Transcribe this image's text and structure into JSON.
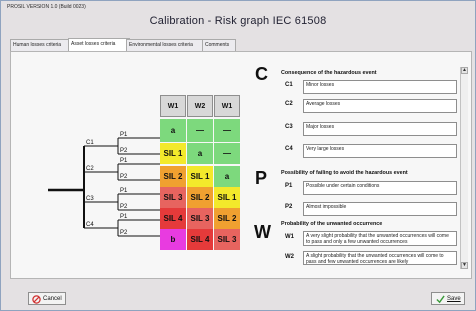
{
  "app": {
    "version_label": "PROSIL VERSION 1.0 (Build 0023)",
    "title": "Calibration - Risk graph IEC 61508"
  },
  "tabs": [
    {
      "label": "Human losses criteria"
    },
    {
      "label": "Asset losses criteria"
    },
    {
      "label": "Environmental losses criteria"
    },
    {
      "label": "Comments"
    }
  ],
  "matrix": {
    "columns": [
      "W1",
      "W2",
      "W1"
    ],
    "rows": [
      [
        "a",
        "—",
        "—"
      ],
      [
        "SIL 1",
        "a",
        "—"
      ],
      [
        "SIL 2",
        "SIL 1",
        "a"
      ],
      [
        "SIL 3",
        "SIL 2",
        "SIL 1"
      ],
      [
        "SIL 4",
        "SIL 3",
        "SIL 2"
      ],
      [
        "b",
        "SIL 4",
        "SIL 3"
      ]
    ],
    "cell_colors": [
      [
        "#7dd97d",
        "#7dd97d",
        "#7dd97d"
      ],
      [
        "#f3e92b",
        "#7dd97d",
        "#7dd97d"
      ],
      [
        "#f0a030",
        "#f3e92b",
        "#7dd97d"
      ],
      [
        "#e7645f",
        "#f0a030",
        "#f3e92b"
      ],
      [
        "#e53a3a",
        "#e7645f",
        "#f0a030"
      ],
      [
        "#e83be0",
        "#e53a3a",
        "#e7645f"
      ]
    ]
  },
  "tree_labels": {
    "c": [
      "C1",
      "C2",
      "C3",
      "C4"
    ],
    "p": [
      "P1",
      "P2",
      "P1",
      "P2",
      "P1",
      "P2",
      "P1",
      "P2"
    ]
  },
  "consequence": {
    "letter": "C",
    "header": "Consequence of the hazardous event",
    "items": [
      {
        "code": "C1",
        "text": "Minor losses"
      },
      {
        "code": "C2",
        "text": "Average losses"
      },
      {
        "code": "C3",
        "text": "Major losses"
      },
      {
        "code": "C4",
        "text": "Very large losses"
      }
    ]
  },
  "avoid": {
    "letter": "P",
    "header": "Possibility of failing to avoid the hazardous event",
    "items": [
      {
        "code": "P1",
        "text": "Possible under certain conditions"
      },
      {
        "code": "P2",
        "text": "Almost impossible"
      }
    ]
  },
  "probability": {
    "letter": "W",
    "header": "Probability of the unwanted occurrence",
    "items": [
      {
        "code": "W1",
        "text": "A very slight probability that the unwanted occurrences will come to pass and only a few unwanted occurrences"
      },
      {
        "code": "W2",
        "text": "A slight probability that the unwanted occurrences will come to pass and few unwanted occurrences are likely"
      }
    ]
  },
  "buttons": {
    "cancel": "Cancel",
    "save": "Save"
  },
  "colors": {
    "cancel_icon": "#d03030",
    "save_icon": "#3a9a3a"
  }
}
